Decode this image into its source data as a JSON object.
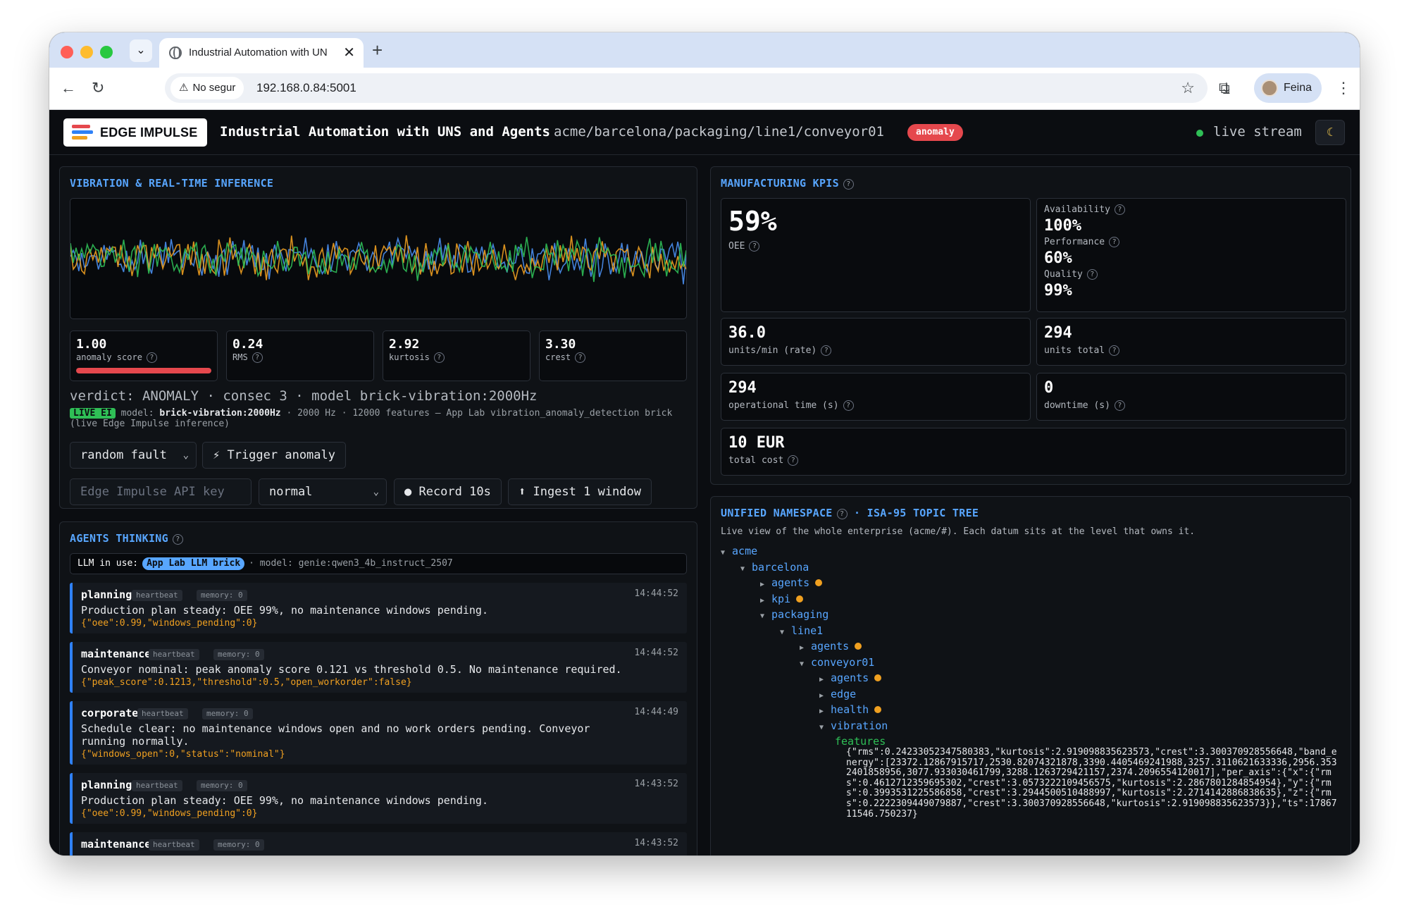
{
  "browser": {
    "tab_title": "Industrial Automation with UN",
    "security_label": "No segur",
    "url": "192.168.0.84:5001",
    "profile_name": "Feina"
  },
  "header": {
    "logo_text": "EDGE IMPULSE",
    "title": "Industrial Automation with UNS and Agents",
    "topic_path": "acme/barcelona/packaging/line1/conveyor01",
    "status_badge": "anomaly",
    "live_label": "live stream",
    "theme_icon": "moon-icon"
  },
  "vibration": {
    "title": "VIBRATION & REAL-TIME INFERENCE",
    "series_colors": [
      "#4a8ff0",
      "#f0a020",
      "#2fbf56"
    ],
    "metrics": [
      {
        "value": "1.00",
        "label": "anomaly score",
        "bar": 1.0,
        "bar_color": "#e5484d"
      },
      {
        "value": "0.24",
        "label": "RMS"
      },
      {
        "value": "2.92",
        "label": "kurtosis"
      },
      {
        "value": "3.30",
        "label": "crest"
      }
    ],
    "verdict": "verdict: ANOMALY · consec 3 · model brick-vibration:2000Hz",
    "live_badge": "LIVE EI",
    "model_prefix": "model:",
    "model_name": "brick-vibration:2000Hz",
    "model_info": "· 2000 Hz · 12000 features — App Lab vibration_anomaly_detection brick (live Edge Impulse inference)",
    "fault_select": "random fault",
    "trigger_button": "⚡ Trigger anomaly",
    "api_key_placeholder": "Edge Impulse API key",
    "mode_select": "normal",
    "record_button": "● Record 10s",
    "ingest_button": "⬆ Ingest 1 window"
  },
  "agents": {
    "title": "AGENTS THINKING",
    "llm_label": "LLM in use:",
    "llm_chip": "App Lab LLM brick",
    "llm_model": "· model: genie:qwen3_4b_instruct_2507",
    "cards": [
      {
        "name": "planning",
        "tag1": "heartbeat",
        "tag2": "memory: 0",
        "time": "14:44:52",
        "msg": "Production plan steady: OEE 99%, no maintenance windows pending.",
        "json": "{\"oee\":0.99,\"windows_pending\":0}"
      },
      {
        "name": "maintenance",
        "tag1": "heartbeat",
        "tag2": "memory: 0",
        "time": "14:44:52",
        "msg": "Conveyor nominal: peak anomaly score 0.121 vs threshold 0.5. No maintenance required.",
        "json": "{\"peak_score\":0.1213,\"threshold\":0.5,\"open_workorder\":false}"
      },
      {
        "name": "corporate",
        "tag1": "heartbeat",
        "tag2": "memory: 0",
        "time": "14:44:49",
        "msg": "Schedule clear: no maintenance windows open and no work orders pending. Conveyor running normally.",
        "json": "{\"windows_open\":0,\"status\":\"nominal\"}"
      },
      {
        "name": "planning",
        "tag1": "heartbeat",
        "tag2": "memory: 0",
        "time": "14:43:52",
        "msg": "Production plan steady: OEE 99%, no maintenance windows pending.",
        "json": "{\"oee\":0.99,\"windows_pending\":0}"
      },
      {
        "name": "maintenance",
        "tag1": "heartbeat",
        "tag2": "memory: 0",
        "time": "14:43:52",
        "msg": "",
        "json": ""
      }
    ]
  },
  "kpis": {
    "title": "MANUFACTURING KPIS",
    "oee_value": "59%",
    "oee_label": "OEE",
    "availability_label": "Availability",
    "availability_value": "100%",
    "performance_label": "Performance",
    "performance_value": "60%",
    "quality_label": "Quality",
    "quality_value": "99%",
    "rate_value": "36.0",
    "rate_label": "units/min (rate)",
    "total_value": "294",
    "total_label": "units total",
    "optime_value": "294",
    "optime_label": "operational time (s)",
    "downtime_value": "0",
    "downtime_label": "downtime (s)",
    "cost_value": "10 EUR",
    "cost_label": "total cost"
  },
  "uns": {
    "title": "UNIFIED NAMESPACE",
    "subtitle": "· ISA-95 TOPIC TREE",
    "description": "Live view of the whole enterprise (acme/#). Each datum sits at the level that owns it.",
    "indicator_color": "#f0a020",
    "tree": [
      {
        "label": "acme",
        "depth": 0,
        "expanded": true,
        "indicator": false
      },
      {
        "label": "barcelona",
        "depth": 1,
        "expanded": true,
        "indicator": false
      },
      {
        "label": "agents",
        "depth": 2,
        "expanded": false,
        "indicator": true
      },
      {
        "label": "kpi",
        "depth": 2,
        "expanded": false,
        "indicator": true
      },
      {
        "label": "packaging",
        "depth": 2,
        "expanded": true,
        "indicator": false
      },
      {
        "label": "line1",
        "depth": 3,
        "expanded": true,
        "indicator": false
      },
      {
        "label": "agents",
        "depth": 4,
        "expanded": false,
        "indicator": true
      },
      {
        "label": "conveyor01",
        "depth": 4,
        "expanded": true,
        "indicator": false
      },
      {
        "label": "agents",
        "depth": 5,
        "expanded": false,
        "indicator": true
      },
      {
        "label": "edge",
        "depth": 5,
        "expanded": false,
        "indicator": false
      },
      {
        "label": "health",
        "depth": 5,
        "expanded": false,
        "indicator": true
      },
      {
        "label": "vibration",
        "depth": 5,
        "expanded": true,
        "indicator": false
      }
    ],
    "leaf_label": "features",
    "leaf_json": "{\"rms\":0.24233052347580383,\"kurtosis\":2.919098835623573,\"crest\":3.300370928556648,\"band_energy\":[23372.12867915717,2530.82074321878,3390.4405469241988,3257.3110621633336,2956.3532401858956,3077.933030461799,3288.1263729421157,2374.2096554120017],\"per_axis\":{\"x\":{\"rms\":0.4612712359695302,\"crest\":3.0573222109456575,\"kurtosis\":2.2867801284854954},\"y\":{\"rms\":0.3993531225586858,\"crest\":3.2944500510488997,\"kurtosis\":2.2714142886838635},\"z\":{\"rms\":0.2222309449079887,\"crest\":3.300370928556648,\"kurtosis\":2.919098835623573}},\"ts\":1786711546.750237}"
  }
}
